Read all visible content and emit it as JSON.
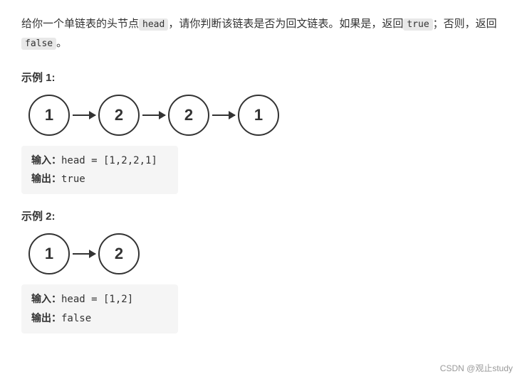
{
  "problem": {
    "desc_prefix": "给你一个单链表的头节点",
    "head_code": "head",
    "desc_middle": "，请你判断该链表是否为回文链表。如果是，返回",
    "true_code": "true",
    "desc_semicolon": "；否则，返回",
    "false_code": "false",
    "desc_suffix": "。"
  },
  "examples": [
    {
      "id": "1",
      "title": "示例 1:",
      "nodes": [
        "1",
        "2",
        "2",
        "1"
      ],
      "input_label": "输入：",
      "input_value": "head = [1,2,2,1]",
      "output_label": "输出：",
      "output_value": "true"
    },
    {
      "id": "2",
      "title": "示例 2:",
      "nodes": [
        "1",
        "2"
      ],
      "input_label": "输入：",
      "input_value": "head = [1,2]",
      "output_label": "输出：",
      "output_value": "false"
    }
  ],
  "watermark": "CSDN @观止study"
}
